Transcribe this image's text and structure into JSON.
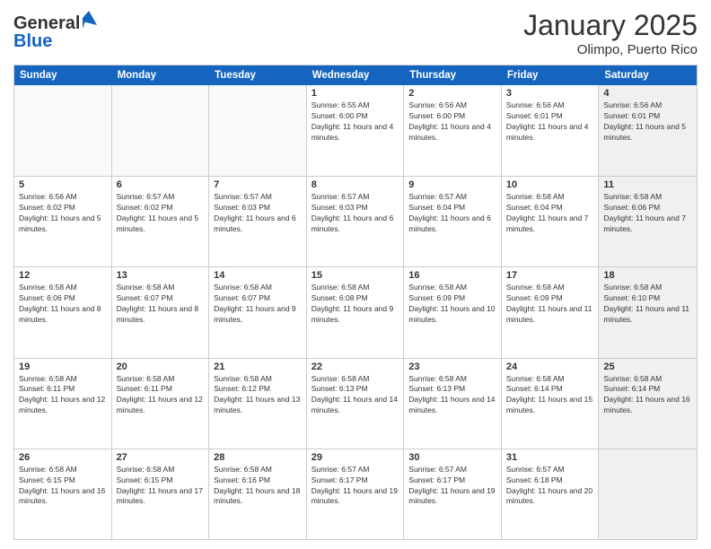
{
  "header": {
    "logo_general": "General",
    "logo_blue": "Blue",
    "month_title": "January 2025",
    "location": "Olimpo, Puerto Rico"
  },
  "calendar": {
    "days_of_week": [
      "Sunday",
      "Monday",
      "Tuesday",
      "Wednesday",
      "Thursday",
      "Friday",
      "Saturday"
    ],
    "weeks": [
      [
        {
          "day": "",
          "empty": true
        },
        {
          "day": "",
          "empty": true
        },
        {
          "day": "",
          "empty": true
        },
        {
          "day": "1",
          "sunrise": "6:55 AM",
          "sunset": "6:00 PM",
          "daylight": "11 hours and 4 minutes."
        },
        {
          "day": "2",
          "sunrise": "6:56 AM",
          "sunset": "6:00 PM",
          "daylight": "11 hours and 4 minutes."
        },
        {
          "day": "3",
          "sunrise": "6:56 AM",
          "sunset": "6:01 PM",
          "daylight": "11 hours and 4 minutes."
        },
        {
          "day": "4",
          "sunrise": "6:56 AM",
          "sunset": "6:01 PM",
          "daylight": "11 hours and 5 minutes.",
          "saturday": true
        }
      ],
      [
        {
          "day": "5",
          "sunrise": "6:56 AM",
          "sunset": "6:02 PM",
          "daylight": "11 hours and 5 minutes."
        },
        {
          "day": "6",
          "sunrise": "6:57 AM",
          "sunset": "6:02 PM",
          "daylight": "11 hours and 5 minutes."
        },
        {
          "day": "7",
          "sunrise": "6:57 AM",
          "sunset": "6:03 PM",
          "daylight": "11 hours and 6 minutes."
        },
        {
          "day": "8",
          "sunrise": "6:57 AM",
          "sunset": "6:03 PM",
          "daylight": "11 hours and 6 minutes."
        },
        {
          "day": "9",
          "sunrise": "6:57 AM",
          "sunset": "6:04 PM",
          "daylight": "11 hours and 6 minutes."
        },
        {
          "day": "10",
          "sunrise": "6:58 AM",
          "sunset": "6:04 PM",
          "daylight": "11 hours and 7 minutes."
        },
        {
          "day": "11",
          "sunrise": "6:58 AM",
          "sunset": "6:06 PM",
          "daylight": "11 hours and 7 minutes.",
          "saturday": true
        }
      ],
      [
        {
          "day": "12",
          "sunrise": "6:58 AM",
          "sunset": "6:06 PM",
          "daylight": "11 hours and 8 minutes."
        },
        {
          "day": "13",
          "sunrise": "6:58 AM",
          "sunset": "6:07 PM",
          "daylight": "11 hours and 8 minutes."
        },
        {
          "day": "14",
          "sunrise": "6:58 AM",
          "sunset": "6:07 PM",
          "daylight": "11 hours and 9 minutes."
        },
        {
          "day": "15",
          "sunrise": "6:58 AM",
          "sunset": "6:08 PM",
          "daylight": "11 hours and 9 minutes."
        },
        {
          "day": "16",
          "sunrise": "6:58 AM",
          "sunset": "6:09 PM",
          "daylight": "11 hours and 10 minutes."
        },
        {
          "day": "17",
          "sunrise": "6:58 AM",
          "sunset": "6:09 PM",
          "daylight": "11 hours and 11 minutes."
        },
        {
          "day": "18",
          "sunrise": "6:58 AM",
          "sunset": "6:10 PM",
          "daylight": "11 hours and 11 minutes.",
          "saturday": true
        }
      ],
      [
        {
          "day": "19",
          "sunrise": "6:58 AM",
          "sunset": "6:11 PM",
          "daylight": "11 hours and 12 minutes."
        },
        {
          "day": "20",
          "sunrise": "6:58 AM",
          "sunset": "6:11 PM",
          "daylight": "11 hours and 12 minutes."
        },
        {
          "day": "21",
          "sunrise": "6:58 AM",
          "sunset": "6:12 PM",
          "daylight": "11 hours and 13 minutes."
        },
        {
          "day": "22",
          "sunrise": "6:58 AM",
          "sunset": "6:13 PM",
          "daylight": "11 hours and 14 minutes."
        },
        {
          "day": "23",
          "sunrise": "6:58 AM",
          "sunset": "6:13 PM",
          "daylight": "11 hours and 14 minutes."
        },
        {
          "day": "24",
          "sunrise": "6:58 AM",
          "sunset": "6:14 PM",
          "daylight": "11 hours and 15 minutes."
        },
        {
          "day": "25",
          "sunrise": "6:58 AM",
          "sunset": "6:14 PM",
          "daylight": "11 hours and 16 minutes.",
          "saturday": true
        }
      ],
      [
        {
          "day": "26",
          "sunrise": "6:58 AM",
          "sunset": "6:15 PM",
          "daylight": "11 hours and 16 minutes."
        },
        {
          "day": "27",
          "sunrise": "6:58 AM",
          "sunset": "6:15 PM",
          "daylight": "11 hours and 17 minutes."
        },
        {
          "day": "28",
          "sunrise": "6:58 AM",
          "sunset": "6:16 PM",
          "daylight": "11 hours and 18 minutes."
        },
        {
          "day": "29",
          "sunrise": "6:57 AM",
          "sunset": "6:17 PM",
          "daylight": "11 hours and 19 minutes."
        },
        {
          "day": "30",
          "sunrise": "6:57 AM",
          "sunset": "6:17 PM",
          "daylight": "11 hours and 19 minutes."
        },
        {
          "day": "31",
          "sunrise": "6:57 AM",
          "sunset": "6:18 PM",
          "daylight": "11 hours and 20 minutes."
        },
        {
          "day": "",
          "empty": true,
          "saturday": true
        }
      ]
    ]
  }
}
